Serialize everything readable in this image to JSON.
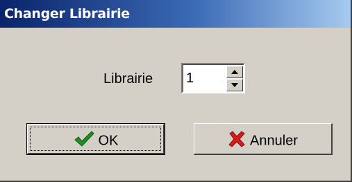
{
  "window": {
    "title": "Changer Librairie"
  },
  "form": {
    "library_label": "Librairie",
    "library_value": "1"
  },
  "buttons": {
    "ok_label": "OK",
    "ok_icon": "checkmark-icon",
    "cancel_label": "Annuler",
    "cancel_icon": "red-x-icon"
  },
  "colors": {
    "title_start": "#0a246a",
    "title_end": "#a6caf0",
    "face": "#d4d0c8",
    "check_green": "#1f8f1f",
    "cancel_red": "#d31d1d"
  }
}
